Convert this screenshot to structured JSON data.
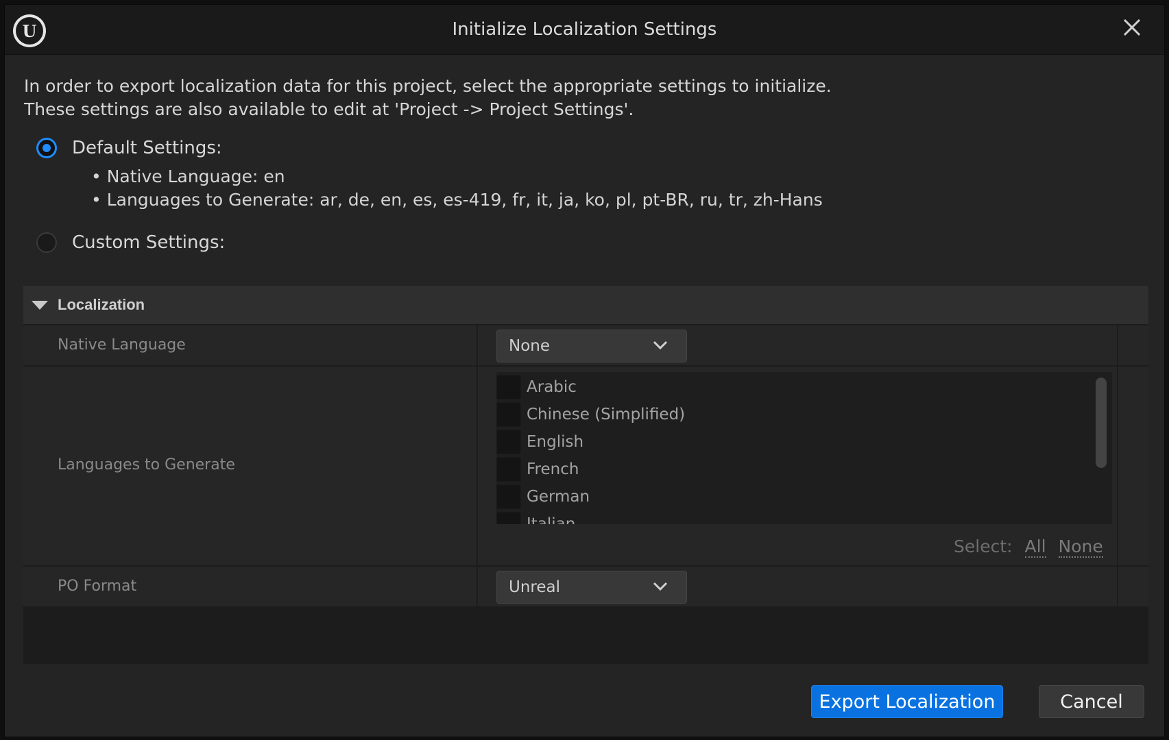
{
  "window": {
    "title": "Initialize Localization Settings",
    "logo_text": "U"
  },
  "intro": {
    "line1": "In order to export localization data for this project, select the appropriate settings to initialize.",
    "line2": "These settings are also available to edit at 'Project -> Project Settings'."
  },
  "options": {
    "default_label": "Default Settings:",
    "default_checked": true,
    "native_language_line": "• Native Language: en",
    "languages_line": "• Languages to Generate: ar, de, en, es, es-419, fr, it, ja, ko, pl, pt-BR, ru, tr, zh-Hans",
    "custom_label": "Custom Settings:",
    "custom_checked": false
  },
  "localization": {
    "section_title": "Localization",
    "native_language": {
      "label": "Native Language",
      "value": "None"
    },
    "languages_to_generate": {
      "label": "Languages to Generate",
      "items": [
        {
          "label": "Arabic",
          "checked": false
        },
        {
          "label": "Chinese (Simplified)",
          "checked": false
        },
        {
          "label": "English",
          "checked": false
        },
        {
          "label": "French",
          "checked": false
        },
        {
          "label": "German",
          "checked": false
        },
        {
          "label": "Italian",
          "checked": false
        }
      ],
      "select_label": "Select:",
      "select_all": "All",
      "select_none": "None"
    },
    "po_format": {
      "label": "PO Format",
      "value": "Unreal"
    }
  },
  "buttons": {
    "export": "Export Localization",
    "cancel": "Cancel"
  },
  "colors": {
    "accent": "#1f8cff",
    "primary_button": "#0a72e0",
    "background": "#242424"
  }
}
